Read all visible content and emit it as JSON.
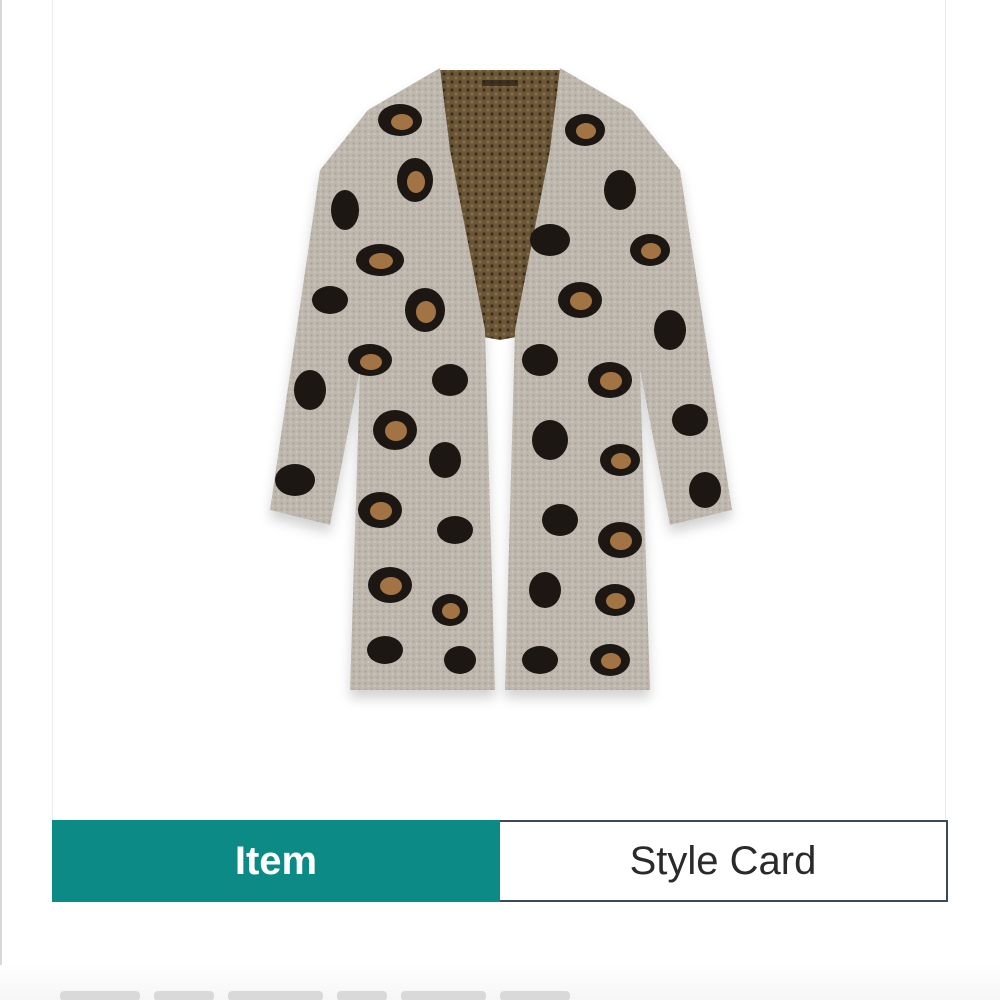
{
  "tabs": {
    "item_label": "Item",
    "style_card_label": "Style Card",
    "active": "item"
  },
  "colors": {
    "accent": "#0c8a85",
    "inactive_border": "#3d4a55",
    "background": "#ffffff"
  },
  "product_image": {
    "subject": "leopard-print-long-cardigan"
  }
}
